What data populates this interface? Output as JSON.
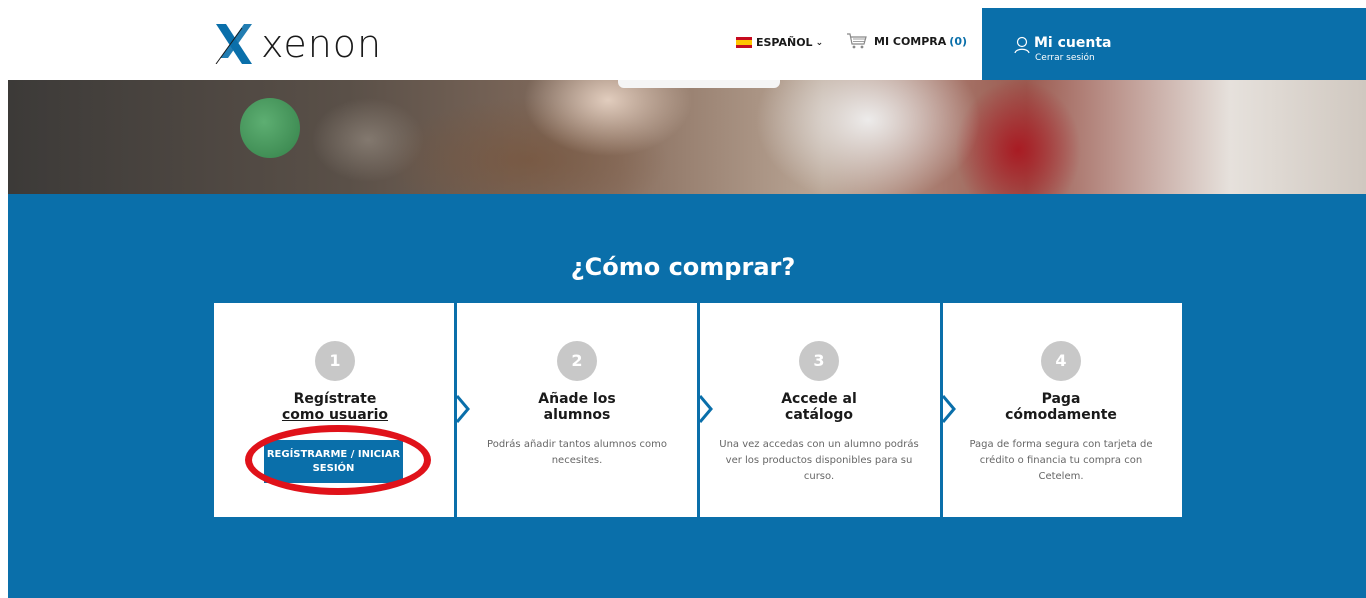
{
  "header": {
    "logo_text": "xenon",
    "language": "ESPAÑOL",
    "cart_label": "MI COMPRA",
    "cart_count": "(0)",
    "account_title": "Mi cuenta",
    "account_subtitle": "Cerrar sesión"
  },
  "main": {
    "title": "¿Cómo comprar?",
    "steps": [
      {
        "number": "1",
        "title_line1": "Regístrate",
        "title_line2": "como usuario",
        "cta": "REGÍSTRARME / INICIAR SESIÓN"
      },
      {
        "number": "2",
        "title_line1": "Añade los",
        "title_line2": "alumnos",
        "description": "Podrás añadir tantos alumnos como necesites."
      },
      {
        "number": "3",
        "title_line1": "Accede al",
        "title_line2": "catálogo",
        "description": "Una vez accedas con un alumno podrás ver los productos disponibles para su curso."
      },
      {
        "number": "4",
        "title_line1": "Paga",
        "title_line2": "cómodamente",
        "description": "Paga de forma segura con tarjeta de crédito o financia tu compra con Cetelem."
      }
    ]
  },
  "colors": {
    "brand_blue": "#0a6faa",
    "highlight_red": "#e0121a"
  }
}
